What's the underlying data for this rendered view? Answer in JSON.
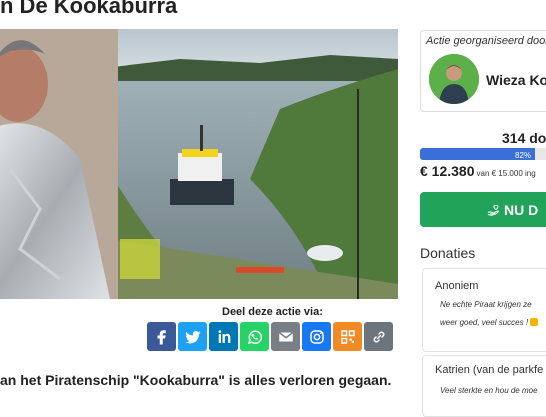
{
  "header": {
    "title": "n De Kookaburra"
  },
  "share": {
    "label": "Deel deze actie via:",
    "buttons": [
      {
        "name": "facebook",
        "color": "#3b5998"
      },
      {
        "name": "twitter",
        "color": "#1da1f2"
      },
      {
        "name": "linkedin",
        "color": "#0077b5"
      },
      {
        "name": "whatsapp",
        "color": "#25d366"
      },
      {
        "name": "email",
        "color": "#7a7f86"
      },
      {
        "name": "instagram",
        "color": "#1877f2"
      },
      {
        "name": "qr-code",
        "color": "#f08a24"
      },
      {
        "name": "link",
        "color": "#6c757d"
      }
    ]
  },
  "story": {
    "text": "an het Piratenschip \"Kookaburra\" is alles verloren gegaan."
  },
  "organizer": {
    "label": "Actie georganiseerd door:",
    "name": "Wieza Ko"
  },
  "stats": {
    "donors": "314 do",
    "progress_percent_label": "82%",
    "progress_fraction": 0.82,
    "raised": "€ 12.380",
    "goal_text": "van € 15.000 ing",
    "colors": {
      "progress": "#3b6fd8",
      "donate": "#21a35a"
    }
  },
  "donate": {
    "label": "NU D"
  },
  "donations": {
    "heading": "Donaties",
    "items": [
      {
        "name": "Anoniem",
        "message_line1": "Ne echte Piraat krijgen ze ",
        "message_line2": "weer goed, veel succes !"
      },
      {
        "name": "Katrien (van de parkfe",
        "message_line1": "Veel sterkte en hou de moe"
      }
    ]
  }
}
